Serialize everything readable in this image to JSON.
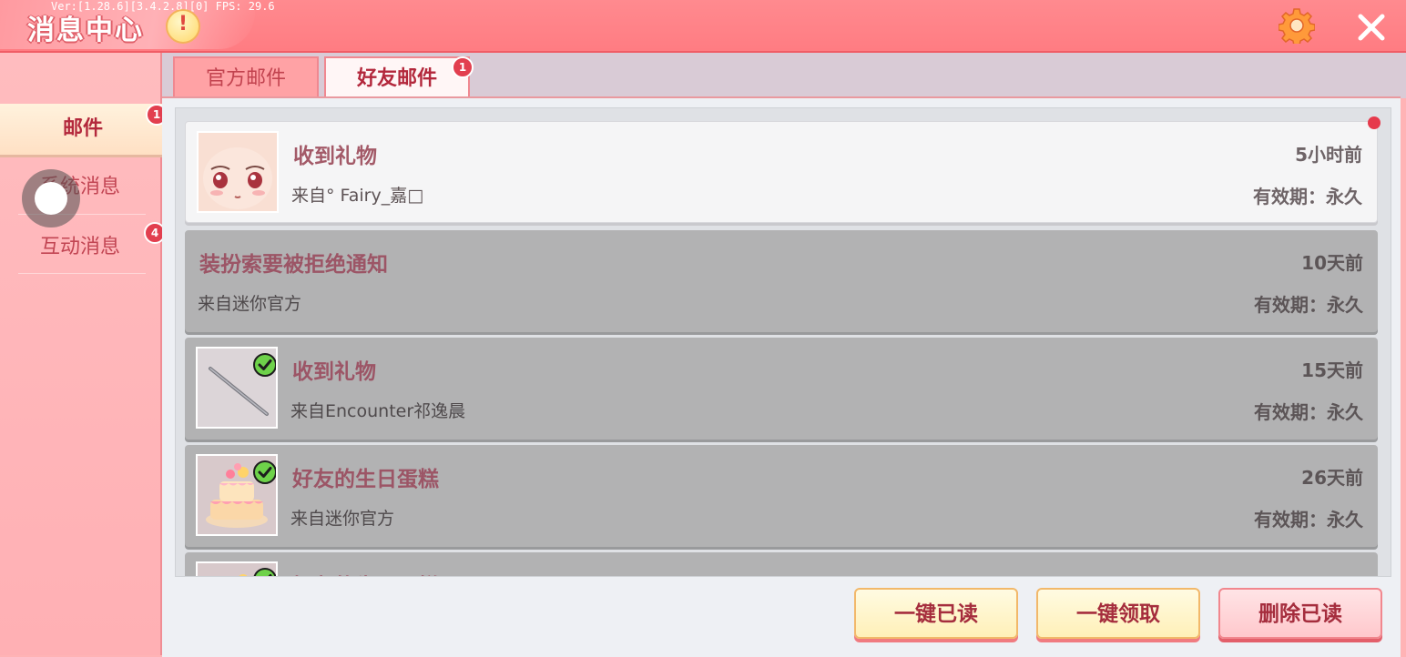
{
  "header": {
    "title": "消息中心",
    "version_text": "Ver:[1.28.6][3.4.2.8][0] FPS: 29.6",
    "warn_icon": "warning-icon",
    "settings_icon": "gear-icon",
    "close_icon": "close-icon",
    "colors": {
      "bar": "#ff7c82",
      "accent": "#f05d66"
    }
  },
  "sidebar": {
    "items": [
      {
        "label": "邮件",
        "badge": "1",
        "active": true
      },
      {
        "label": "系统消息",
        "badge": "",
        "active": false
      },
      {
        "label": "互动消息",
        "badge": "4",
        "active": false
      }
    ]
  },
  "tabs": [
    {
      "label": "官方邮件",
      "active": false,
      "badge": ""
    },
    {
      "label": "好友邮件",
      "active": true,
      "badge": "1"
    }
  ],
  "mails": [
    {
      "title": "收到礼物",
      "from": "来自° Fairy_嘉□",
      "time": "5小时前",
      "validity": "有效期：永久",
      "read": false,
      "icon": "character-face-icon",
      "claimed": false
    },
    {
      "title": "装扮索要被拒绝通知",
      "from": "来自迷你官方",
      "time": "10天前",
      "validity": "有效期：永久",
      "read": true,
      "icon": "",
      "claimed": false
    },
    {
      "title": "收到礼物",
      "from": "来自Encounter祁逸晨",
      "time": "15天前",
      "validity": "有效期：永久",
      "read": true,
      "icon": "wand-icon",
      "claimed": true
    },
    {
      "title": "好友的生日蛋糕",
      "from": "来自迷你官方",
      "time": "26天前",
      "validity": "有效期：永久",
      "read": true,
      "icon": "birthday-cake-icon",
      "claimed": true
    },
    {
      "title": "好友的生日蛋糕",
      "from": "",
      "time": "",
      "validity": "",
      "read": true,
      "icon": "birthday-cake-icon",
      "claimed": true
    }
  ],
  "buttons": {
    "read_all": "一键已读",
    "claim_all": "一键领取",
    "delete_read": "删除已读"
  }
}
